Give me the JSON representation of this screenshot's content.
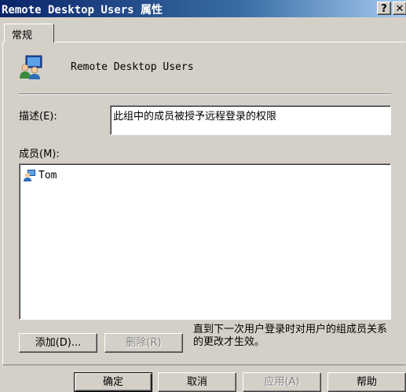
{
  "window": {
    "title": "Remote Desktop Users 属性",
    "help_glyph": "?",
    "close_glyph": "✕"
  },
  "tabs": [
    {
      "label": "常规"
    }
  ],
  "group": {
    "name": "Remote Desktop Users",
    "description_label": "描述(E):",
    "description_value": "此组中的成员被授予远程登录的权限",
    "members_label": "成员(M):",
    "members": [
      {
        "name": "Tom",
        "icon": "user-icon"
      }
    ]
  },
  "member_actions": {
    "add_label": "添加(D)...",
    "remove_label": "删除(R)"
  },
  "note": "直到下一次用户登录时对用户的组成员关系的更改才生效。",
  "dialog_buttons": {
    "ok": "确定",
    "cancel": "取消",
    "apply": "应用(A)",
    "help": "帮助"
  },
  "colors": {
    "face": "#d4d0c8",
    "title_start": "#0a246a",
    "title_end": "#a6caf0"
  }
}
